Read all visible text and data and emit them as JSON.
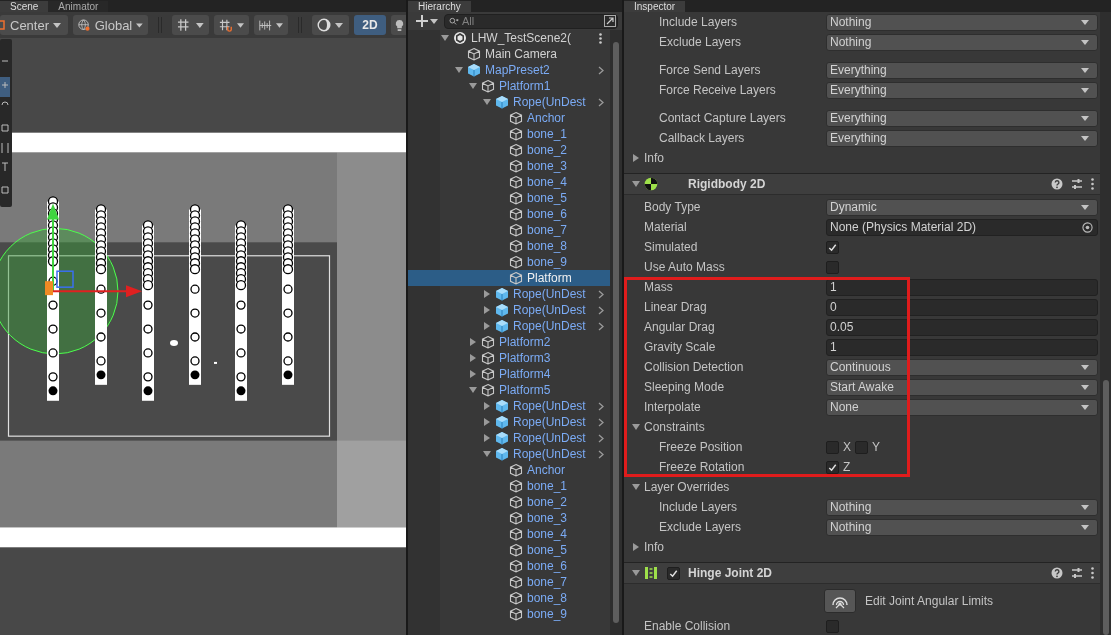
{
  "scene_panel": {
    "tabs": [
      {
        "label": "Scene",
        "selected": true
      },
      {
        "label": "Animator",
        "selected": false
      }
    ],
    "toolbar": {
      "pivot_mode": "Center",
      "pivot_rotation": "Global",
      "view_2d": {
        "label": "2D",
        "selected": true
      }
    }
  },
  "hierarchy": {
    "tab": "Hierarchy",
    "search": {
      "placeholder": "All"
    },
    "tree": [
      {
        "name": "LHW_TestScene2(",
        "kind": "scene",
        "expanded": true,
        "selected": false,
        "children": [
          {
            "name": "Main Camera",
            "kind": "object",
            "selected": false
          },
          {
            "name": "MapPreset2",
            "kind": "prefab",
            "expanded": true,
            "selected": false,
            "children": [
              {
                "name": "Platform1",
                "kind": "prefab_part",
                "expanded": true,
                "selected": false,
                "children": [
                  {
                    "name": "Rope(UnDest",
                    "kind": "prefab",
                    "expanded": true,
                    "selected": false,
                    "children": [
                      {
                        "name": "Anchor",
                        "kind": "prefab_part",
                        "selected": false
                      },
                      {
                        "name": "bone_1",
                        "kind": "prefab_part",
                        "selected": false
                      },
                      {
                        "name": "bone_2",
                        "kind": "prefab_part",
                        "selected": false
                      },
                      {
                        "name": "bone_3",
                        "kind": "prefab_part",
                        "selected": false
                      },
                      {
                        "name": "bone_4",
                        "kind": "prefab_part",
                        "selected": false
                      },
                      {
                        "name": "bone_5",
                        "kind": "prefab_part",
                        "selected": false
                      },
                      {
                        "name": "bone_6",
                        "kind": "prefab_part",
                        "selected": false
                      },
                      {
                        "name": "bone_7",
                        "kind": "prefab_part",
                        "selected": false
                      },
                      {
                        "name": "bone_8",
                        "kind": "prefab_part",
                        "selected": false
                      },
                      {
                        "name": "bone_9",
                        "kind": "prefab_part",
                        "selected": false
                      },
                      {
                        "name": "Platform",
                        "kind": "prefab_part",
                        "selected": true
                      }
                    ]
                  },
                  {
                    "name": "Rope(UnDest",
                    "kind": "prefab",
                    "expanded": false,
                    "selected": false
                  },
                  {
                    "name": "Rope(UnDest",
                    "kind": "prefab",
                    "expanded": false,
                    "selected": false
                  },
                  {
                    "name": "Rope(UnDest",
                    "kind": "prefab",
                    "expanded": false,
                    "selected": false
                  }
                ]
              },
              {
                "name": "Platform2",
                "kind": "prefab_part",
                "expanded": false,
                "selected": false
              },
              {
                "name": "Platform3",
                "kind": "prefab_part",
                "expanded": false,
                "selected": false
              },
              {
                "name": "Platform4",
                "kind": "prefab_part",
                "expanded": false,
                "selected": false
              },
              {
                "name": "Platform5",
                "kind": "prefab_part",
                "expanded": true,
                "selected": false,
                "children": [
                  {
                    "name": "Rope(UnDest",
                    "kind": "prefab",
                    "expanded": false,
                    "selected": false
                  },
                  {
                    "name": "Rope(UnDest",
                    "kind": "prefab",
                    "expanded": false,
                    "selected": false
                  },
                  {
                    "name": "Rope(UnDest",
                    "kind": "prefab",
                    "expanded": false,
                    "selected": false
                  },
                  {
                    "name": "Rope(UnDest",
                    "kind": "prefab",
                    "expanded": true,
                    "selected": false,
                    "children": [
                      {
                        "name": "Anchor",
                        "kind": "prefab_part",
                        "selected": false
                      },
                      {
                        "name": "bone_1",
                        "kind": "prefab_part",
                        "selected": false
                      },
                      {
                        "name": "bone_2",
                        "kind": "prefab_part",
                        "selected": false
                      },
                      {
                        "name": "bone_3",
                        "kind": "prefab_part",
                        "selected": false
                      },
                      {
                        "name": "bone_4",
                        "kind": "prefab_part",
                        "selected": false
                      },
                      {
                        "name": "bone_5",
                        "kind": "prefab_part",
                        "selected": false
                      },
                      {
                        "name": "bone_6",
                        "kind": "prefab_part",
                        "selected": false
                      },
                      {
                        "name": "bone_7",
                        "kind": "prefab_part",
                        "selected": false
                      },
                      {
                        "name": "bone_8",
                        "kind": "prefab_part",
                        "selected": false
                      },
                      {
                        "name": "bone_9",
                        "kind": "prefab_part",
                        "selected": false
                      }
                    ]
                  }
                ]
              }
            ]
          }
        ]
      }
    ]
  },
  "inspector": {
    "tab": "Inspector",
    "layer_groups": [
      [
        {
          "kind": "dropdown",
          "label": "Include Layers",
          "value": "Nothing"
        },
        {
          "kind": "dropdown",
          "label": "Exclude Layers",
          "value": "Nothing"
        }
      ],
      [
        {
          "kind": "dropdown",
          "label": "Force Send Layers",
          "value": "Everything"
        },
        {
          "kind": "dropdown",
          "label": "Force Receive Layers",
          "value": "Everything"
        }
      ],
      [
        {
          "kind": "dropdown",
          "label": "Contact Capture Layers",
          "value": "Everything"
        },
        {
          "kind": "dropdown",
          "label": "Callback Layers",
          "value": "Everything"
        }
      ]
    ],
    "info": {
      "label": "Info",
      "expanded": false
    },
    "components": [
      {
        "title": "Rigidbody 2D",
        "kind": "rigidbody",
        "expanded": true,
        "fields": [
          {
            "kind": "dropdown",
            "label": "Body Type",
            "value": "Dynamic"
          },
          {
            "kind": "object",
            "label": "Material",
            "value": "None (Physics Material 2D)"
          },
          {
            "kind": "checkbox",
            "label": "Simulated",
            "checked": true
          },
          {
            "kind": "checkbox",
            "label": "Use Auto Mass",
            "checked": false
          },
          {
            "kind": "highlight",
            "fields": [
              {
                "kind": "number",
                "label": "Mass",
                "value": "1"
              },
              {
                "kind": "number",
                "label": "Linear Drag",
                "value": "0"
              },
              {
                "kind": "number",
                "label": "Angular Drag",
                "value": "0.05"
              },
              {
                "kind": "number",
                "label": "Gravity Scale",
                "value": "1"
              },
              {
                "kind": "dropdown",
                "label": "Collision Detection",
                "value": "Continuous"
              },
              {
                "kind": "dropdown",
                "label": "Sleeping Mode",
                "value": "Start Awake"
              },
              {
                "kind": "dropdown",
                "label": "Interpolate",
                "value": "None"
              },
              {
                "kind": "foldout",
                "label": "Constraints",
                "expanded": true,
                "children": [
                  {
                    "kind": "axes",
                    "label": "Freeze Position",
                    "axes": [
                      {
                        "label": "X",
                        "checked": false
                      },
                      {
                        "label": "Y",
                        "checked": false
                      }
                    ]
                  },
                  {
                    "kind": "axes",
                    "label": "Freeze Rotation",
                    "axes": [
                      {
                        "label": "Z",
                        "checked": true
                      }
                    ]
                  }
                ]
              }
            ]
          },
          {
            "kind": "foldout",
            "label": "Layer Overrides",
            "expanded": true,
            "children": [
              {
                "kind": "dropdown",
                "label": "Include Layers",
                "value": "Nothing"
              },
              {
                "kind": "dropdown",
                "label": "Exclude Layers",
                "value": "Nothing"
              }
            ]
          },
          {
            "kind": "foldout",
            "label": "Info",
            "expanded": false
          }
        ]
      },
      {
        "title": "Hinge Joint 2D",
        "kind": "joint",
        "enabled": true,
        "expanded": true,
        "fields": [
          {
            "kind": "tool_button",
            "label": "Edit Joint Angular Limits"
          },
          {
            "kind": "checkbox",
            "label": "Enable Collision",
            "checked": false
          }
        ]
      }
    ]
  }
}
